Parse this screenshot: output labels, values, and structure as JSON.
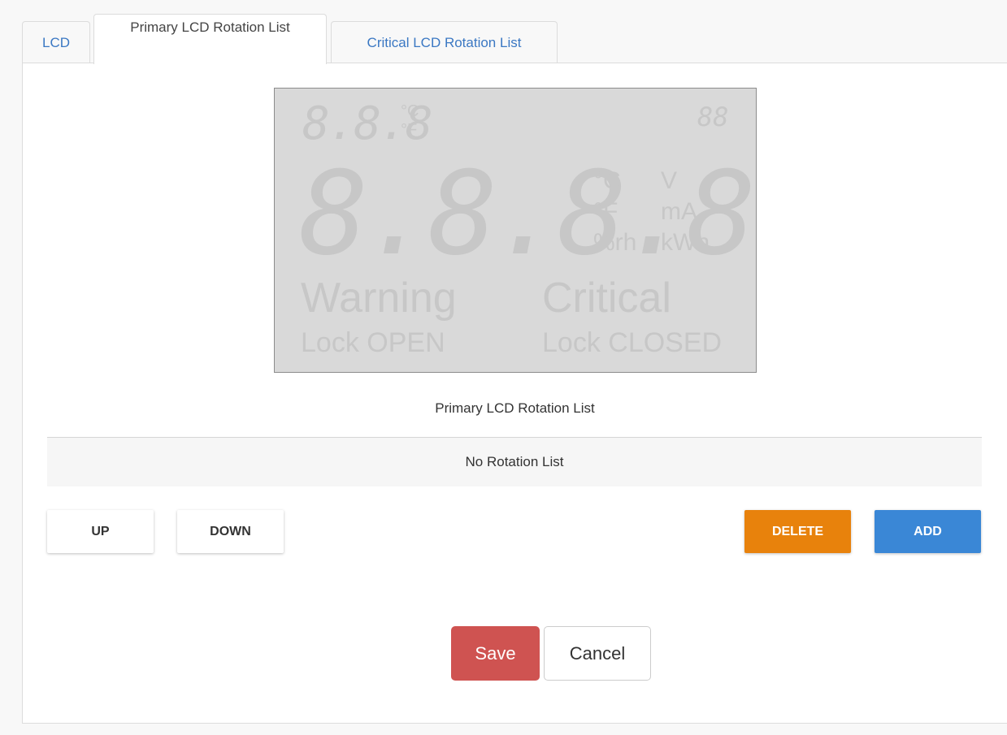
{
  "tabs": {
    "lcd": "LCD",
    "primary": "Primary LCD Rotation List",
    "critical": "Critical LCD Rotation List",
    "active": "primary"
  },
  "lcd_preview": {
    "small_digits": "8.8.8",
    "small_unit_c": "°C",
    "small_unit_f": "°F",
    "corner_digits": "88",
    "big_digits": "8.8.8.8",
    "unit_c": "°C",
    "unit_f": "°F",
    "unit_rh": "%rh",
    "unit_v": "V",
    "unit_ma": "mA",
    "unit_kwh": "kWh",
    "warning": "Warning",
    "critical": "Critical",
    "lock_open": "Lock OPEN",
    "lock_closed": "Lock CLOSED"
  },
  "rotation_list": {
    "title": "Primary LCD Rotation List",
    "empty_text": "No Rotation List",
    "items": []
  },
  "buttons": {
    "up": "UP",
    "down": "DOWN",
    "delete": "DELETE",
    "add": "ADD",
    "save": "Save",
    "cancel": "Cancel"
  },
  "colors": {
    "tab_link": "#3b78c3",
    "delete": "#e8820c",
    "add": "#3a87d6",
    "save": "#cf5351",
    "lcd_bg": "#d9d9d9"
  }
}
